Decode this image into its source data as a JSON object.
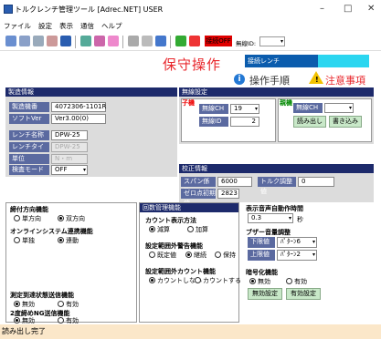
{
  "window": {
    "title": "トルクレンチ管理ツール [Adrec.NET] USER",
    "minimize": "–",
    "maximize": "□",
    "close": "✕"
  },
  "menu": [
    "ファイル",
    "設定",
    "表示",
    "通信",
    "ヘルプ"
  ],
  "toolbar": {
    "red_button": "接続OFF",
    "id_label": "無線ID:",
    "id_value": ""
  },
  "header": {
    "title": "保守操作",
    "connect_label": "接続レンチ",
    "procedure": "操作手順",
    "caution": "注意事項"
  },
  "manufacture": {
    "header": "製造情報",
    "machine_label": "製造機番",
    "machine_value": "4072306-1101R",
    "soft_label": "ソフトVer",
    "soft_value": "Ver3.00(0)",
    "wrench_label": "レンチ名称",
    "wrench_value": "DPW-25",
    "type_label": "レンチタイプ",
    "type_value": "DPW-25",
    "unit_label": "単位",
    "unit_value": "N・m",
    "detect_label": "検査モード",
    "detect_value": "OFF"
  },
  "wireless": {
    "header": "無線設定",
    "child": "子機",
    "ch_label": "無線CH",
    "ch_value": "19",
    "id_label": "無線ID",
    "id_value": "2",
    "parent": "親機",
    "pch_label": "無線CH",
    "pch_value": "",
    "read_btn": "読み出し",
    "write_btn": "書き込み"
  },
  "calibration": {
    "header": "校正情報",
    "span_label": "スパン係数",
    "span_value": "6000",
    "torque_label": "トルク調整値",
    "torque_value": "0",
    "zero_label": "ゼロ点初期値",
    "zero_value": "2823"
  },
  "direction": {
    "title": "締付方向機能",
    "opt1": "単方向",
    "opt2": "双方向"
  },
  "online": {
    "title": "オンラインシステム連携機能",
    "opt1": "単独",
    "opt2": "連動"
  },
  "measure": {
    "title": "測定到達状態送信機能",
    "opt1": "無効",
    "opt2": "有効"
  },
  "double": {
    "title": "2度締めNG送信機能",
    "opt1": "無効",
    "opt2": "有効"
  },
  "loop": {
    "header": "回数管理機能",
    "count_title": "カウント表示方法",
    "c_opt1": "減算",
    "c_opt2": "加算",
    "warn_title": "設定範囲外警告機能",
    "w_opt1": "既定値",
    "w_opt2": "継続",
    "w_opt3": "保持",
    "outcount_title": "設定範囲外カウント機能",
    "o_opt1": "カウントしない",
    "o_opt2": "カウントする"
  },
  "display": {
    "title": "表示音声自動作時間",
    "time_value": "0.3",
    "time_unit": "秒"
  },
  "buzzer": {
    "title": "ブザー音量調整",
    "low_label": "下限値",
    "low_value": "ﾊﾟﾀｰﾝ6",
    "up_label": "上限値",
    "up_value": "ﾊﾟﾀｰﾝ2"
  },
  "crypto": {
    "title": "暗号化機能",
    "opt1": "無効",
    "opt2": "有効",
    "btn1": "無効設定",
    "btn2": "有効設定"
  },
  "status": "読み出し完了"
}
